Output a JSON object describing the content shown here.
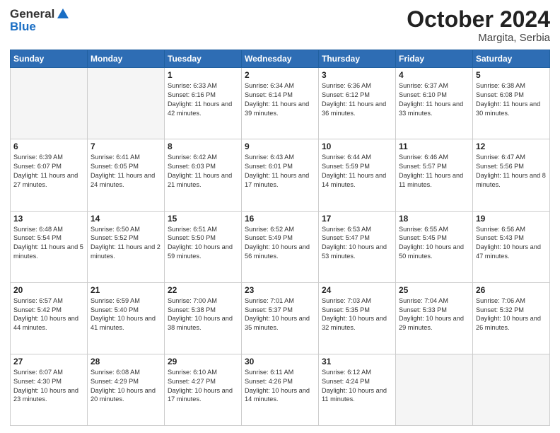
{
  "header": {
    "logo_general": "General",
    "logo_blue": "Blue",
    "title": "October 2024",
    "location": "Margita, Serbia"
  },
  "days_of_week": [
    "Sunday",
    "Monday",
    "Tuesday",
    "Wednesday",
    "Thursday",
    "Friday",
    "Saturday"
  ],
  "weeks": [
    [
      {
        "day": "",
        "info": ""
      },
      {
        "day": "",
        "info": ""
      },
      {
        "day": "1",
        "info": "Sunrise: 6:33 AM\nSunset: 6:16 PM\nDaylight: 11 hours and 42 minutes."
      },
      {
        "day": "2",
        "info": "Sunrise: 6:34 AM\nSunset: 6:14 PM\nDaylight: 11 hours and 39 minutes."
      },
      {
        "day": "3",
        "info": "Sunrise: 6:36 AM\nSunset: 6:12 PM\nDaylight: 11 hours and 36 minutes."
      },
      {
        "day": "4",
        "info": "Sunrise: 6:37 AM\nSunset: 6:10 PM\nDaylight: 11 hours and 33 minutes."
      },
      {
        "day": "5",
        "info": "Sunrise: 6:38 AM\nSunset: 6:08 PM\nDaylight: 11 hours and 30 minutes."
      }
    ],
    [
      {
        "day": "6",
        "info": "Sunrise: 6:39 AM\nSunset: 6:07 PM\nDaylight: 11 hours and 27 minutes."
      },
      {
        "day": "7",
        "info": "Sunrise: 6:41 AM\nSunset: 6:05 PM\nDaylight: 11 hours and 24 minutes."
      },
      {
        "day": "8",
        "info": "Sunrise: 6:42 AM\nSunset: 6:03 PM\nDaylight: 11 hours and 21 minutes."
      },
      {
        "day": "9",
        "info": "Sunrise: 6:43 AM\nSunset: 6:01 PM\nDaylight: 11 hours and 17 minutes."
      },
      {
        "day": "10",
        "info": "Sunrise: 6:44 AM\nSunset: 5:59 PM\nDaylight: 11 hours and 14 minutes."
      },
      {
        "day": "11",
        "info": "Sunrise: 6:46 AM\nSunset: 5:57 PM\nDaylight: 11 hours and 11 minutes."
      },
      {
        "day": "12",
        "info": "Sunrise: 6:47 AM\nSunset: 5:56 PM\nDaylight: 11 hours and 8 minutes."
      }
    ],
    [
      {
        "day": "13",
        "info": "Sunrise: 6:48 AM\nSunset: 5:54 PM\nDaylight: 11 hours and 5 minutes."
      },
      {
        "day": "14",
        "info": "Sunrise: 6:50 AM\nSunset: 5:52 PM\nDaylight: 11 hours and 2 minutes."
      },
      {
        "day": "15",
        "info": "Sunrise: 6:51 AM\nSunset: 5:50 PM\nDaylight: 10 hours and 59 minutes."
      },
      {
        "day": "16",
        "info": "Sunrise: 6:52 AM\nSunset: 5:49 PM\nDaylight: 10 hours and 56 minutes."
      },
      {
        "day": "17",
        "info": "Sunrise: 6:53 AM\nSunset: 5:47 PM\nDaylight: 10 hours and 53 minutes."
      },
      {
        "day": "18",
        "info": "Sunrise: 6:55 AM\nSunset: 5:45 PM\nDaylight: 10 hours and 50 minutes."
      },
      {
        "day": "19",
        "info": "Sunrise: 6:56 AM\nSunset: 5:43 PM\nDaylight: 10 hours and 47 minutes."
      }
    ],
    [
      {
        "day": "20",
        "info": "Sunrise: 6:57 AM\nSunset: 5:42 PM\nDaylight: 10 hours and 44 minutes."
      },
      {
        "day": "21",
        "info": "Sunrise: 6:59 AM\nSunset: 5:40 PM\nDaylight: 10 hours and 41 minutes."
      },
      {
        "day": "22",
        "info": "Sunrise: 7:00 AM\nSunset: 5:38 PM\nDaylight: 10 hours and 38 minutes."
      },
      {
        "day": "23",
        "info": "Sunrise: 7:01 AM\nSunset: 5:37 PM\nDaylight: 10 hours and 35 minutes."
      },
      {
        "day": "24",
        "info": "Sunrise: 7:03 AM\nSunset: 5:35 PM\nDaylight: 10 hours and 32 minutes."
      },
      {
        "day": "25",
        "info": "Sunrise: 7:04 AM\nSunset: 5:33 PM\nDaylight: 10 hours and 29 minutes."
      },
      {
        "day": "26",
        "info": "Sunrise: 7:06 AM\nSunset: 5:32 PM\nDaylight: 10 hours and 26 minutes."
      }
    ],
    [
      {
        "day": "27",
        "info": "Sunrise: 6:07 AM\nSunset: 4:30 PM\nDaylight: 10 hours and 23 minutes."
      },
      {
        "day": "28",
        "info": "Sunrise: 6:08 AM\nSunset: 4:29 PM\nDaylight: 10 hours and 20 minutes."
      },
      {
        "day": "29",
        "info": "Sunrise: 6:10 AM\nSunset: 4:27 PM\nDaylight: 10 hours and 17 minutes."
      },
      {
        "day": "30",
        "info": "Sunrise: 6:11 AM\nSunset: 4:26 PM\nDaylight: 10 hours and 14 minutes."
      },
      {
        "day": "31",
        "info": "Sunrise: 6:12 AM\nSunset: 4:24 PM\nDaylight: 10 hours and 11 minutes."
      },
      {
        "day": "",
        "info": ""
      },
      {
        "day": "",
        "info": ""
      }
    ]
  ]
}
